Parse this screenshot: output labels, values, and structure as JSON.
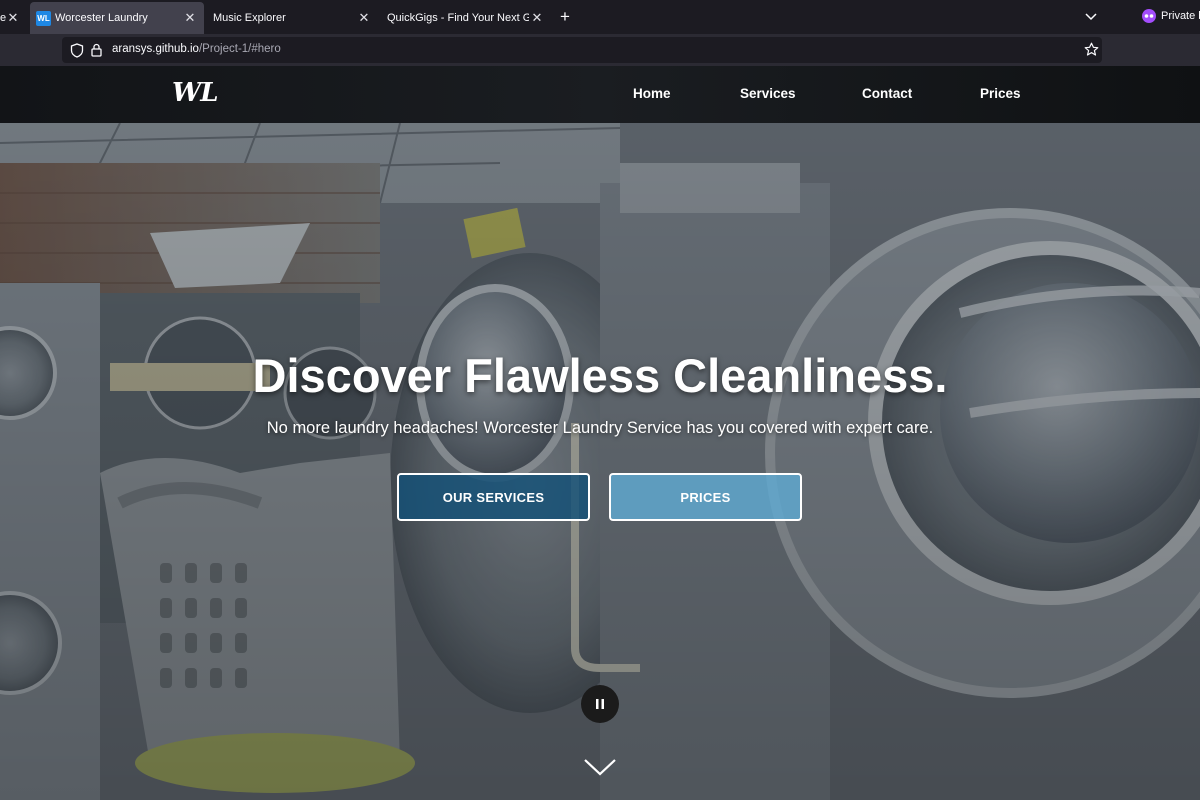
{
  "browser": {
    "tabs": [
      {
        "label": "ev",
        "active": false
      },
      {
        "label": "Worcester Laundry",
        "active": true,
        "favicon": "WL"
      },
      {
        "label": "Music Explorer",
        "active": false
      },
      {
        "label": "QuickGigs - Find Your Next Gig",
        "active": false
      }
    ],
    "close_glyph": "✕",
    "new_tab_glyph": "+",
    "private_label": "Private br",
    "url_host": "aransys.github.io",
    "url_path": "/Project-1/#hero"
  },
  "site": {
    "logo": "WL",
    "nav": [
      {
        "label": "Home"
      },
      {
        "label": "Services"
      },
      {
        "label": "Contact"
      },
      {
        "label": "Prices"
      }
    ]
  },
  "hero": {
    "title": "Discover Flawless Cleanliness.",
    "subtitle": "No more laundry headaches! Worcester Laundry Service has you covered with expert care.",
    "buttons": [
      {
        "label": "OUR SERVICES",
        "color": "#145078"
      },
      {
        "label": "PRICES",
        "color": "#5faad2"
      }
    ],
    "video_control": "pause-icon",
    "scroll_indicator": "chevron-down-icon"
  },
  "colors": {
    "browser_bg": "#1c1b22",
    "active_tab": "#42414d",
    "navbar": "#16191c",
    "favicon": "#1e88e5",
    "private_badge": "#a34dfc"
  }
}
